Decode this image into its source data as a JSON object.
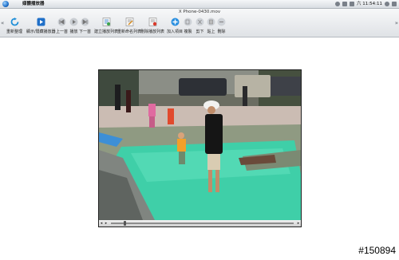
{
  "menubar": {
    "app_name": "媒體播放器",
    "status_text": "六 11:54:11"
  },
  "window": {
    "title": "X Phone-0430.mov"
  },
  "toolbar": {
    "buttons": [
      {
        "label": "重新整理",
        "icon": "refresh-icon"
      },
      {
        "label": "顯示/隱藏播放器",
        "icon": "play-player-icon"
      },
      {
        "label": "上一首",
        "icon": "previous-icon"
      },
      {
        "label": "播放",
        "icon": "play-icon"
      },
      {
        "label": "下一首",
        "icon": "next-icon"
      },
      {
        "label": "建立播放列表",
        "icon": "create-playlist-icon"
      },
      {
        "label": "重新命名列表",
        "icon": "rename-playlist-icon"
      },
      {
        "label": "刪除播放列表",
        "icon": "delete-playlist-icon"
      },
      {
        "label": "加入項目",
        "icon": "add-item-icon"
      },
      {
        "label": "複製",
        "icon": "copy-icon"
      },
      {
        "label": "剪下",
        "icon": "cut-icon"
      },
      {
        "label": "貼上",
        "icon": "paste-icon"
      },
      {
        "label": "刪除",
        "icon": "delete-icon"
      }
    ]
  },
  "player": {
    "progress": 0.07
  },
  "watermark": "#150894",
  "colors": {
    "accent": "#1f6fc8",
    "water": "#3fcfa8",
    "toolbar_bg": "#e6e9ec"
  }
}
